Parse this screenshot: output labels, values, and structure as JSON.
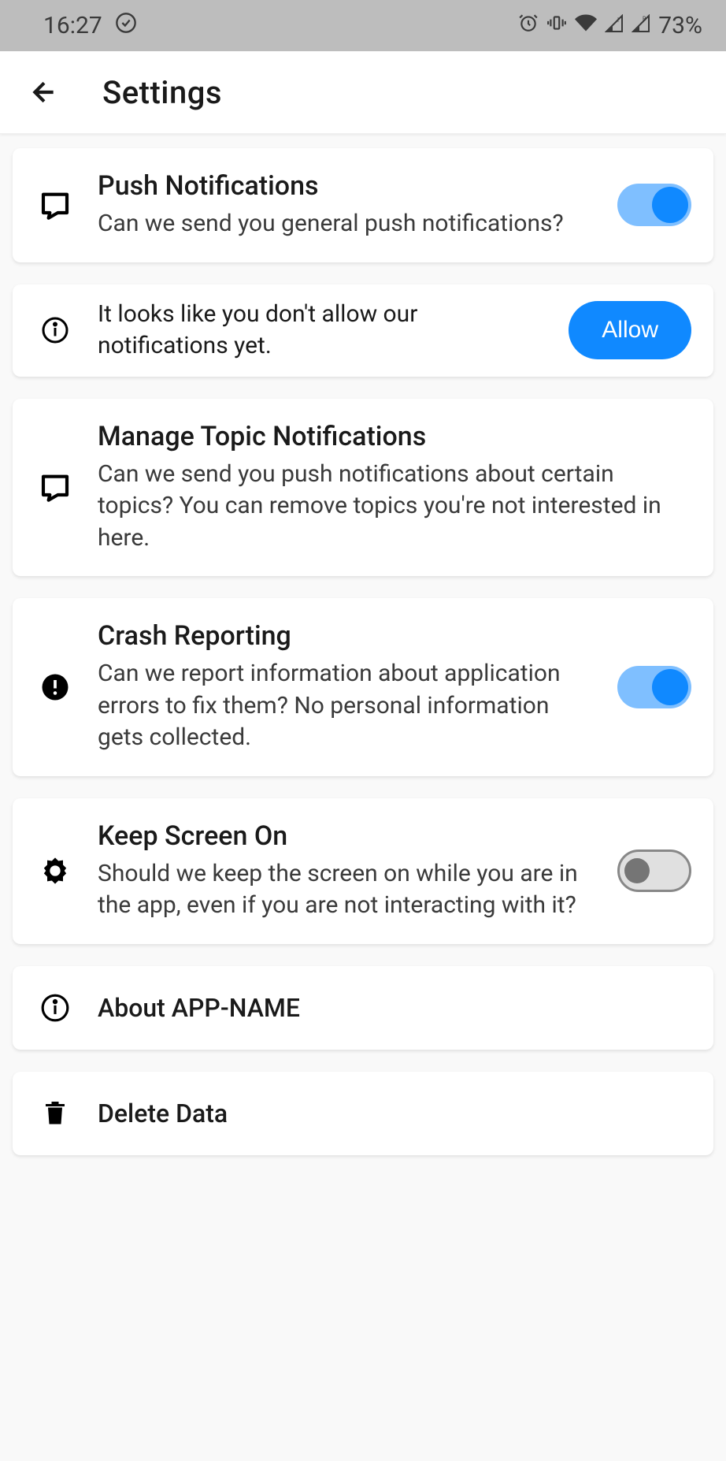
{
  "statusBar": {
    "time": "16:27",
    "battery": "73%"
  },
  "appBar": {
    "title": "Settings"
  },
  "cards": {
    "pushNotifications": {
      "title": "Push Notifications",
      "description": "Can we send you general push notifications?",
      "toggled": true
    },
    "permissionPrompt": {
      "text": "It looks like you don't allow our notifications yet.",
      "buttonLabel": "Allow"
    },
    "topicNotifications": {
      "title": "Manage Topic Notifications",
      "description": "Can we send you push notifications about certain topics? You can remove topics you're not interested in here."
    },
    "crashReporting": {
      "title": "Crash Reporting",
      "description": "Can we report information about application errors to fix them? No personal information gets collected.",
      "toggled": true
    },
    "keepScreenOn": {
      "title": "Keep Screen On",
      "description": "Should we keep the screen on while you are in the app, even if you are not interacting with it?",
      "toggled": false
    },
    "about": {
      "title": "About APP-NAME"
    },
    "deleteData": {
      "title": "Delete Data"
    }
  }
}
